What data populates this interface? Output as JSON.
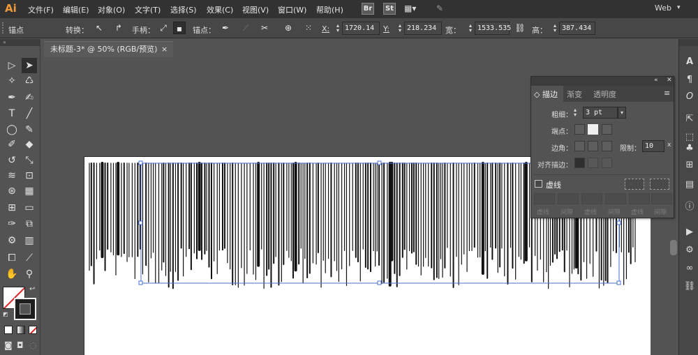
{
  "app": {
    "logo": "Ai",
    "workspace": "Web"
  },
  "menu": [
    "文件(F)",
    "编辑(E)",
    "对象(O)",
    "文字(T)",
    "选择(S)",
    "效果(C)",
    "视图(V)",
    "窗口(W)",
    "帮助(H)"
  ],
  "menubar_badges": [
    "Br",
    "St"
  ],
  "control": {
    "selection_label": "锚点",
    "convert_label": "转换：",
    "handles_label": "手柄：",
    "anchors_label": "锚点：",
    "x_label": "X:",
    "x_value": "1720.14",
    "y_label": "Y:",
    "y_value": "218.234",
    "w_label": "宽：",
    "w_value": "1533.535",
    "h_label": "高：",
    "h_value": "387.434"
  },
  "document": {
    "tab_title": "未标题-3* @ 50% (RGB/预览)",
    "close": "×"
  },
  "stroke_panel": {
    "tabs": [
      {
        "label": "描边",
        "active": true
      },
      {
        "label": "渐变",
        "active": false
      },
      {
        "label": "透明度",
        "active": false
      }
    ],
    "weight_label": "粗细：",
    "weight_value": "3 pt",
    "cap_label": "端点：",
    "corner_label": "边角：",
    "limit_label": "限制：",
    "limit_value": "10",
    "limit_unit": "x",
    "align_label": "对齐描边：",
    "dashed_label": "虚线",
    "dash_field_labels": [
      "虚线",
      "间隙",
      "虚线",
      "间隙",
      "虚线",
      "间隙"
    ],
    "menu_icon": "hamburger-icon",
    "collapse_icon": "double-arrow-icon",
    "close_icon": "close-icon"
  },
  "colors": {
    "menubar": "#323232",
    "controlbar": "#474747",
    "canvas": "#535353",
    "accent": "#f09a3a",
    "selection": "#4a6fd6"
  }
}
